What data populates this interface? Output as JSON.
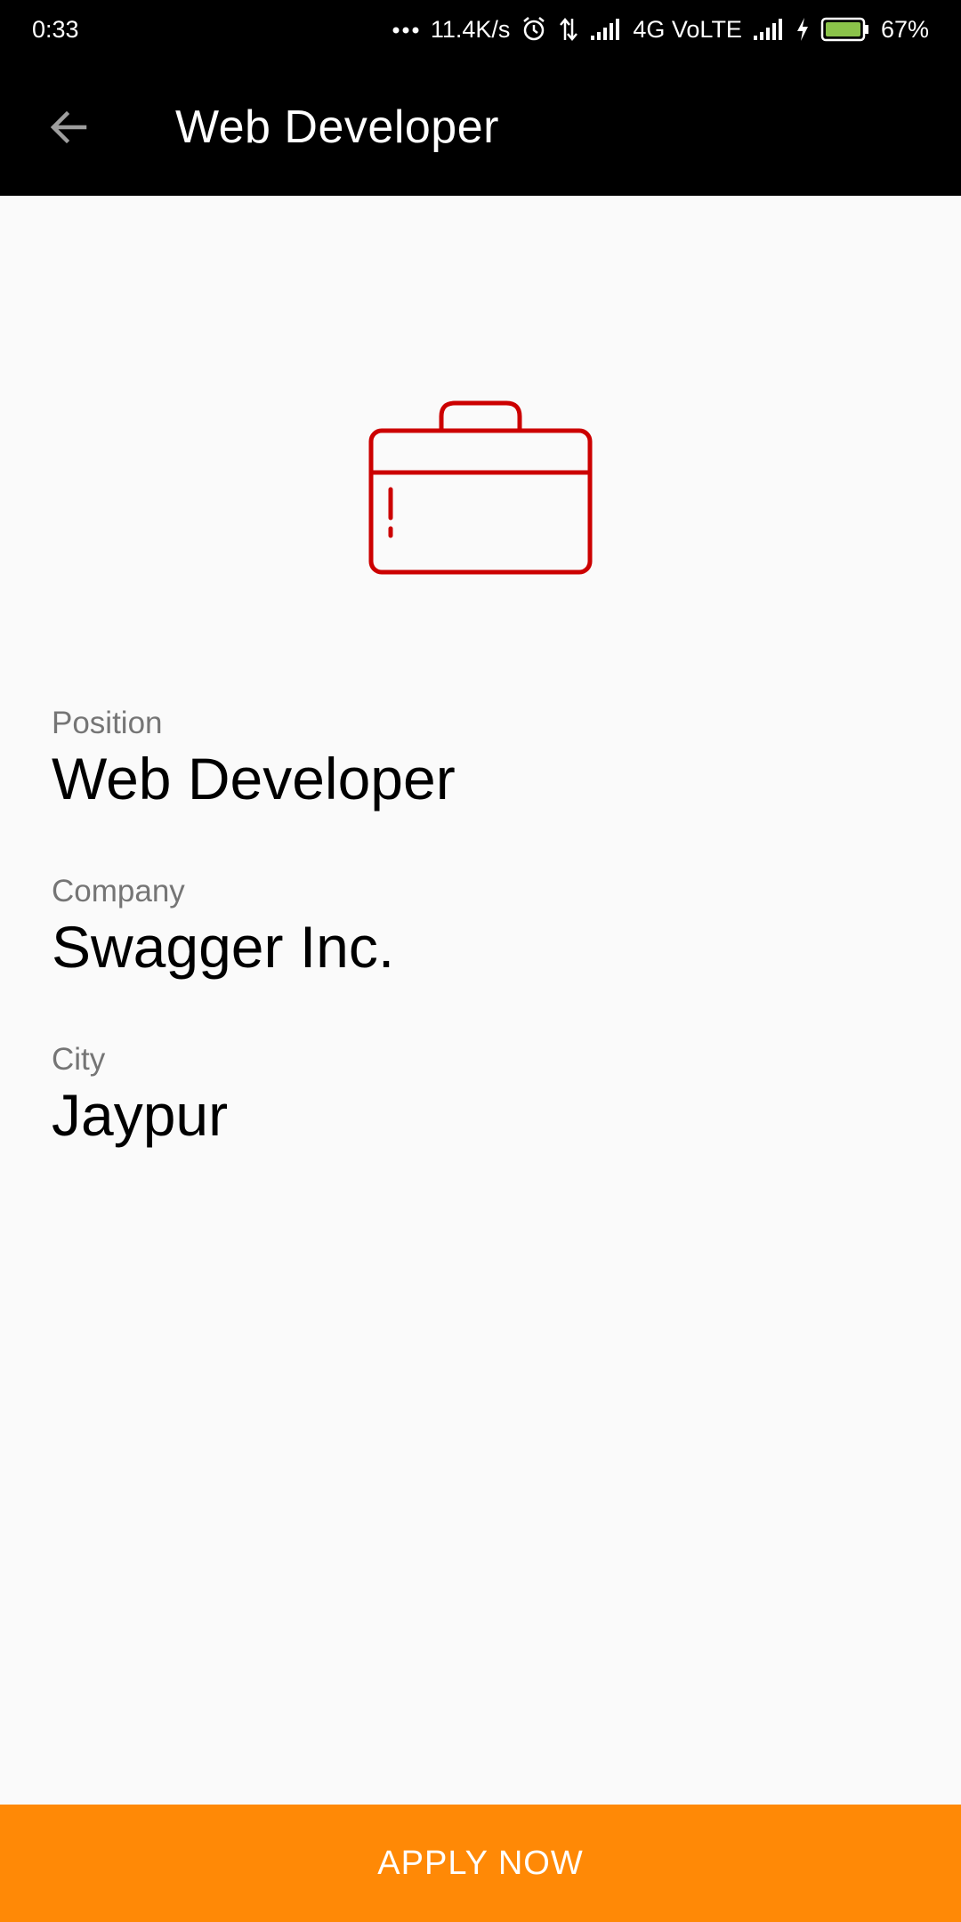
{
  "status_bar": {
    "time": "0:33",
    "network_speed": "11.4K/s",
    "network_type": "4G VoLTE",
    "battery_percent": "67%",
    "icons": [
      "more-dots-icon",
      "alarm-icon",
      "data-transfer-icon",
      "signal-icon",
      "signal-icon",
      "charging-icon",
      "battery-icon"
    ],
    "battery_color": "#8bc34a"
  },
  "app_bar": {
    "back_icon": "arrow-back-icon",
    "title": "Web Developer"
  },
  "hero": {
    "icon": "briefcase-icon",
    "color": "#cc0000"
  },
  "details": {
    "position": {
      "label": "Position",
      "value": "Web Developer"
    },
    "company": {
      "label": "Company",
      "value": "Swagger Inc."
    },
    "city": {
      "label": "City",
      "value": "Jaypur"
    }
  },
  "apply_button": {
    "label": "APPLY NOW",
    "color": "#ff8906"
  }
}
